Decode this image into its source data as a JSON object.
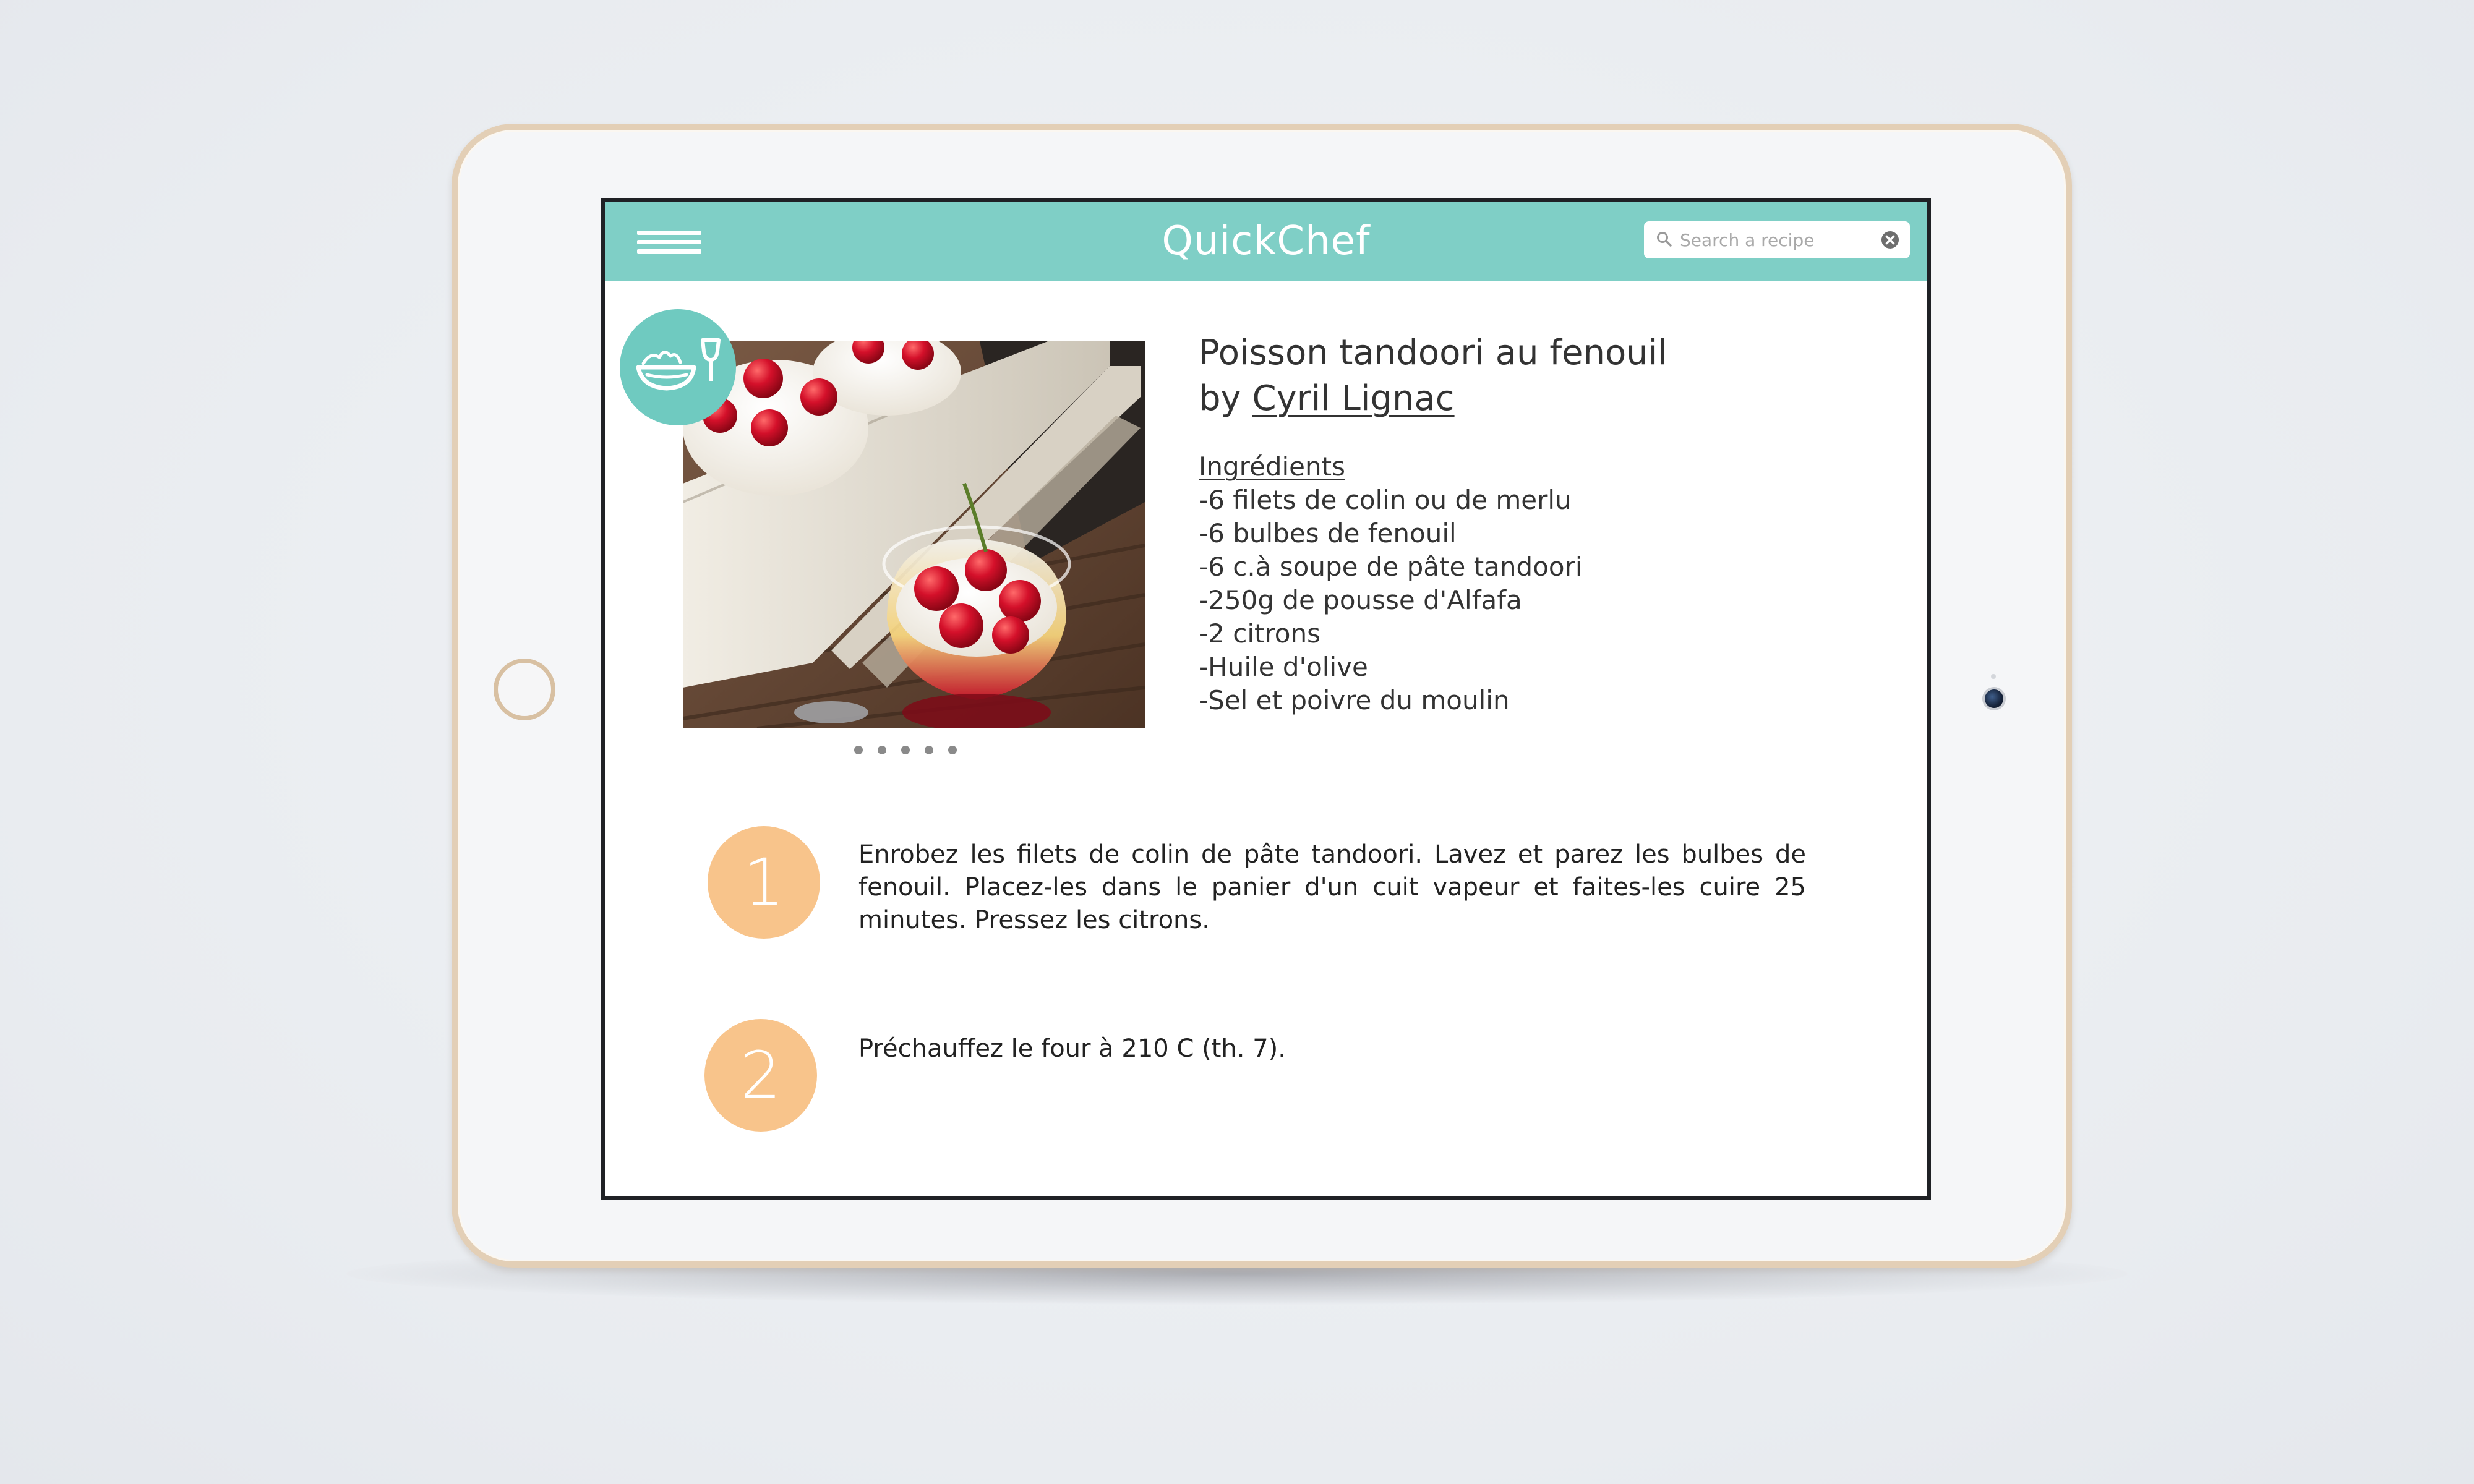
{
  "app": {
    "title": "QuickChef"
  },
  "search": {
    "placeholder": "Search a recipe",
    "value": ""
  },
  "colors": {
    "header": "#7fcfc6",
    "badge": "#6fcac0",
    "step_circle": "#f8c48b",
    "device_frame": "#e3cfb6"
  },
  "icons": {
    "menu": "hamburger-menu-icon",
    "search": "search-icon",
    "clear": "clear-icon",
    "category": "salad-wine-icon"
  },
  "recipe": {
    "title": "Poisson tandoori au fenouil",
    "by_prefix": "by",
    "author": "Cyril Lignac",
    "ingredients_heading": "Ingrédients",
    "ingredients": [
      "-6 filets de colin ou de merlu",
      "-6 bulbes de fenouil",
      "-6 c.à soupe de pâte tandoori",
      "-250g de pousse d'Alfafa",
      "-2 citrons",
      "-Huile d'olive",
      "-Sel et poivre du moulin"
    ],
    "gallery": {
      "image_count": 5,
      "active_index": 0
    }
  },
  "steps": [
    {
      "number": "1",
      "text": "Enrobez les filets de colin de pâte tandoori. Lavez et parez les bulbes de fenouil. Placez-les dans le panier d'un cuit vapeur et faites-les cuire 25 minutes. Pressez les citrons."
    },
    {
      "number": "2",
      "text": "Préchauffez le four à 210 C (th. 7)."
    }
  ]
}
